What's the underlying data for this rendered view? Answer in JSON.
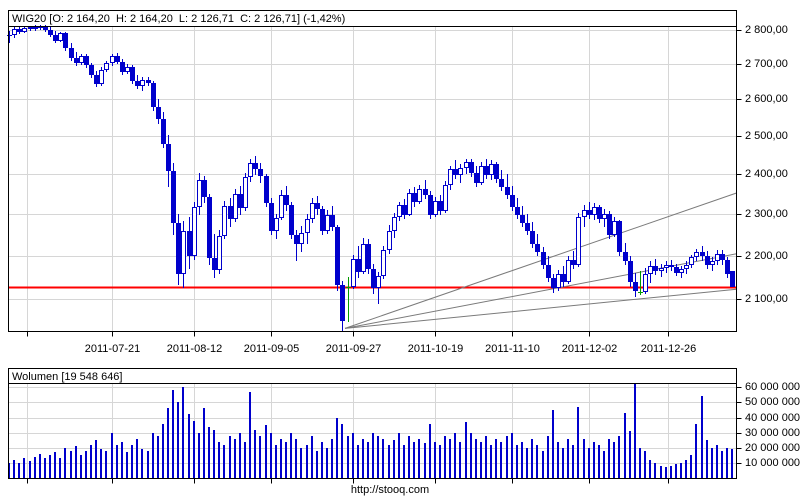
{
  "page": {
    "footer_url": "http://stooq.com"
  },
  "colors": {
    "candle_down": "#0000cc",
    "candle_up_fill": "#ffffff",
    "candle_special": "#009900",
    "volume_bar": "#0000cc",
    "red_line": "#ff0000",
    "trendline": "#7a7a7a",
    "grid": "#d6d6d6",
    "frame": "#000000"
  },
  "chart_data": {
    "type": "candlestick",
    "symbol": "WIG20",
    "title": "WIG20 [O: 2 164,20  H: 2 164,20  L: 2 126,71  C: 2 126,71] (-1,42%)",
    "volume_title": "Wolumen [19 548 646]",
    "ohlc_display": {
      "open": "2 164,20",
      "high": "2 164,20",
      "low": "2 126,71",
      "close": "2 126,71",
      "change": "-1,42%"
    },
    "scale": "log",
    "price_axis": {
      "ticks": [
        {
          "value": 2800,
          "label": "2 800,00"
        },
        {
          "value": 2700,
          "label": "2 700,00"
        },
        {
          "value": 2600,
          "label": "2 600,00"
        },
        {
          "value": 2500,
          "label": "2 500,00"
        },
        {
          "value": 2400,
          "label": "2 400,00"
        },
        {
          "value": 2300,
          "label": "2 300,00"
        },
        {
          "value": 2200,
          "label": "2 200,00"
        },
        {
          "value": 2100,
          "label": "2 100,00"
        }
      ]
    },
    "volume_axis": {
      "unit": "millions",
      "ticks": [
        {
          "value": 60,
          "label": "60 000 000"
        },
        {
          "value": 50,
          "label": "50 000 000"
        },
        {
          "value": 40,
          "label": "40 000 000"
        },
        {
          "value": 30,
          "label": "30 000 000"
        },
        {
          "value": 20,
          "label": "20 000 000"
        },
        {
          "value": 10,
          "label": "10 000 000"
        }
      ]
    },
    "x_axis": {
      "ticks": [
        {
          "i": 3.5,
          "label": ""
        },
        {
          "i": 20,
          "label": "2011-07-21"
        },
        {
          "i": 36,
          "label": "2011-08-12"
        },
        {
          "i": 51,
          "label": "2011-09-05"
        },
        {
          "i": 67,
          "label": "2011-09-27"
        },
        {
          "i": 83,
          "label": "2011-10-19"
        },
        {
          "i": 98,
          "label": "2011-11-10"
        },
        {
          "i": 113,
          "label": "2011-12-02"
        },
        {
          "i": 128.5,
          "label": "2011-12-26"
        }
      ]
    },
    "red_line_value": 2126.71,
    "trendlines": [
      {
        "from_i": 65.5,
        "from_price": 2035,
        "to_i": 142,
        "to_price": 2352
      },
      {
        "from_i": 65.5,
        "from_price": 2035,
        "to_i": 142,
        "to_price": 2204
      },
      {
        "from_i": 65.5,
        "from_price": 2035,
        "to_i": 142,
        "to_price": 2122
      }
    ],
    "special_candles": [
      66,
      123
    ],
    "candles_ohlcv": [
      [
        2784,
        2796,
        2760,
        2784,
        10
      ],
      [
        2784,
        2808,
        2776,
        2802,
        12
      ],
      [
        2802,
        2810,
        2788,
        2794,
        10
      ],
      [
        2794,
        2812,
        2790,
        2806,
        13
      ],
      [
        2806,
        2812,
        2796,
        2808,
        11
      ],
      [
        2808,
        2814,
        2798,
        2810,
        14
      ],
      [
        2810,
        2815,
        2800,
        2812,
        16
      ],
      [
        2812,
        2814,
        2794,
        2800,
        13
      ],
      [
        2800,
        2808,
        2780,
        2786,
        15
      ],
      [
        2786,
        2798,
        2760,
        2768,
        17
      ],
      [
        2768,
        2794,
        2764,
        2790,
        13
      ],
      [
        2790,
        2794,
        2738,
        2746,
        20
      ],
      [
        2746,
        2760,
        2708,
        2718,
        18
      ],
      [
        2718,
        2736,
        2694,
        2702,
        21
      ],
      [
        2702,
        2730,
        2696,
        2724,
        15
      ],
      [
        2724,
        2730,
        2688,
        2696,
        18
      ],
      [
        2696,
        2704,
        2660,
        2668,
        22
      ],
      [
        2668,
        2680,
        2634,
        2642,
        25
      ],
      [
        2642,
        2690,
        2638,
        2684,
        19
      ],
      [
        2684,
        2710,
        2676,
        2702,
        18
      ],
      [
        2702,
        2730,
        2694,
        2724,
        30
      ],
      [
        2724,
        2732,
        2700,
        2706,
        22
      ],
      [
        2706,
        2714,
        2668,
        2676,
        24
      ],
      [
        2676,
        2700,
        2670,
        2692,
        17
      ],
      [
        2692,
        2696,
        2642,
        2650,
        22
      ],
      [
        2650,
        2668,
        2628,
        2638,
        26
      ],
      [
        2638,
        2662,
        2624,
        2654,
        19
      ],
      [
        2654,
        2664,
        2636,
        2646,
        18
      ],
      [
        2646,
        2650,
        2568,
        2578,
        30
      ],
      [
        2578,
        2600,
        2532,
        2546,
        28
      ],
      [
        2546,
        2564,
        2468,
        2478,
        36
      ],
      [
        2478,
        2502,
        2368,
        2408,
        46
      ],
      [
        2408,
        2430,
        2248,
        2278,
        58
      ],
      [
        2278,
        2300,
        2132,
        2158,
        50
      ],
      [
        2158,
        2282,
        2124,
        2258,
        60
      ],
      [
        2258,
        2292,
        2168,
        2198,
        42
      ],
      [
        2198,
        2330,
        2190,
        2318,
        38
      ],
      [
        2318,
        2402,
        2298,
        2386,
        30
      ],
      [
        2386,
        2396,
        2328,
        2342,
        46
      ],
      [
        2342,
        2350,
        2178,
        2194,
        34
      ],
      [
        2194,
        2252,
        2148,
        2166,
        32
      ],
      [
        2166,
        2262,
        2158,
        2246,
        24
      ],
      [
        2246,
        2332,
        2240,
        2320,
        22
      ],
      [
        2320,
        2340,
        2268,
        2288,
        28
      ],
      [
        2288,
        2362,
        2280,
        2350,
        26
      ],
      [
        2350,
        2370,
        2298,
        2314,
        30
      ],
      [
        2314,
        2402,
        2308,
        2392,
        24
      ],
      [
        2392,
        2440,
        2380,
        2428,
        57
      ],
      [
        2428,
        2446,
        2398,
        2414,
        32
      ],
      [
        2414,
        2430,
        2378,
        2394,
        28
      ],
      [
        2394,
        2400,
        2318,
        2328,
        35
      ],
      [
        2328,
        2340,
        2248,
        2258,
        30
      ],
      [
        2258,
        2300,
        2238,
        2290,
        22
      ],
      [
        2290,
        2360,
        2284,
        2348,
        26
      ],
      [
        2348,
        2370,
        2308,
        2322,
        24
      ],
      [
        2322,
        2330,
        2238,
        2248,
        30
      ],
      [
        2248,
        2260,
        2188,
        2228,
        26
      ],
      [
        2228,
        2270,
        2208,
        2254,
        20
      ],
      [
        2254,
        2300,
        2228,
        2288,
        22
      ],
      [
        2288,
        2340,
        2278,
        2328,
        28
      ],
      [
        2328,
        2344,
        2298,
        2312,
        18
      ],
      [
        2312,
        2320,
        2248,
        2258,
        24
      ],
      [
        2258,
        2310,
        2252,
        2298,
        20
      ],
      [
        2298,
        2320,
        2258,
        2268,
        26
      ],
      [
        2268,
        2274,
        2118,
        2132,
        40
      ],
      [
        2132,
        2140,
        2030,
        2052,
        36
      ],
      [
        2126,
        2150,
        2048,
        2126,
        28
      ],
      [
        2126,
        2202,
        2122,
        2192,
        30
      ],
      [
        2192,
        2222,
        2148,
        2162,
        22
      ],
      [
        2162,
        2242,
        2158,
        2228,
        26
      ],
      [
        2228,
        2238,
        2158,
        2168,
        24
      ],
      [
        2168,
        2180,
        2112,
        2124,
        30
      ],
      [
        2124,
        2162,
        2088,
        2152,
        28
      ],
      [
        2152,
        2222,
        2146,
        2212,
        26
      ],
      [
        2212,
        2272,
        2204,
        2258,
        22
      ],
      [
        2258,
        2302,
        2242,
        2292,
        25
      ],
      [
        2292,
        2330,
        2282,
        2322,
        30
      ],
      [
        2322,
        2336,
        2288,
        2298,
        22
      ],
      [
        2298,
        2362,
        2294,
        2352,
        28
      ],
      [
        2352,
        2366,
        2318,
        2330,
        24
      ],
      [
        2330,
        2372,
        2324,
        2362,
        26
      ],
      [
        2362,
        2386,
        2338,
        2348,
        23
      ],
      [
        2348,
        2356,
        2288,
        2298,
        36
      ],
      [
        2298,
        2342,
        2292,
        2332,
        24
      ],
      [
        2332,
        2346,
        2298,
        2308,
        22
      ],
      [
        2308,
        2382,
        2302,
        2372,
        28
      ],
      [
        2372,
        2422,
        2360,
        2412,
        26
      ],
      [
        2412,
        2436,
        2388,
        2398,
        30
      ],
      [
        2398,
        2426,
        2378,
        2416,
        24
      ],
      [
        2416,
        2440,
        2400,
        2432,
        37
      ],
      [
        2432,
        2438,
        2392,
        2402,
        30
      ],
      [
        2402,
        2420,
        2368,
        2378,
        26
      ],
      [
        2378,
        2432,
        2372,
        2422,
        24
      ],
      [
        2422,
        2440,
        2388,
        2398,
        28
      ],
      [
        2398,
        2436,
        2384,
        2426,
        22
      ],
      [
        2426,
        2432,
        2378,
        2388,
        26
      ],
      [
        2388,
        2410,
        2358,
        2368,
        24
      ],
      [
        2368,
        2400,
        2338,
        2348,
        28
      ],
      [
        2348,
        2370,
        2308,
        2318,
        30
      ],
      [
        2318,
        2340,
        2288,
        2298,
        22
      ],
      [
        2298,
        2320,
        2268,
        2278,
        24
      ],
      [
        2278,
        2300,
        2248,
        2258,
        20
      ],
      [
        2258,
        2280,
        2218,
        2228,
        26
      ],
      [
        2228,
        2250,
        2198,
        2208,
        22
      ],
      [
        2208,
        2220,
        2168,
        2178,
        18
      ],
      [
        2178,
        2200,
        2138,
        2148,
        28
      ],
      [
        2148,
        2158,
        2114,
        2124,
        45
      ],
      [
        2124,
        2166,
        2118,
        2156,
        24
      ],
      [
        2156,
        2176,
        2128,
        2138,
        20
      ],
      [
        2138,
        2200,
        2134,
        2190,
        26
      ],
      [
        2190,
        2210,
        2168,
        2178,
        22
      ],
      [
        2178,
        2302,
        2174,
        2292,
        47
      ],
      [
        2292,
        2322,
        2268,
        2310,
        26
      ],
      [
        2310,
        2330,
        2288,
        2298,
        20
      ],
      [
        2298,
        2326,
        2284,
        2316,
        24
      ],
      [
        2316,
        2322,
        2278,
        2288,
        22
      ],
      [
        2288,
        2312,
        2268,
        2300,
        18
      ],
      [
        2300,
        2306,
        2238,
        2248,
        26
      ],
      [
        2248,
        2292,
        2244,
        2282,
        24
      ],
      [
        2282,
        2286,
        2198,
        2208,
        28
      ],
      [
        2208,
        2230,
        2178,
        2188,
        43
      ],
      [
        2188,
        2200,
        2128,
        2138,
        31
      ],
      [
        2138,
        2160,
        2104,
        2118,
        63
      ],
      [
        2116,
        2164,
        2108,
        2116,
        20
      ],
      [
        2116,
        2170,
        2112,
        2156,
        18
      ],
      [
        2156,
        2186,
        2136,
        2176,
        12
      ],
      [
        2176,
        2192,
        2154,
        2164,
        10
      ],
      [
        2164,
        2180,
        2150,
        2170,
        8
      ],
      [
        2170,
        2186,
        2160,
        2178,
        7
      ],
      [
        2178,
        2190,
        2164,
        2172,
        8
      ],
      [
        2172,
        2180,
        2152,
        2160,
        9
      ],
      [
        2160,
        2176,
        2148,
        2168,
        10
      ],
      [
        2168,
        2186,
        2158,
        2178,
        12
      ],
      [
        2178,
        2202,
        2170,
        2196,
        15
      ],
      [
        2196,
        2216,
        2186,
        2208,
        36
      ],
      [
        2208,
        2222,
        2188,
        2198,
        54
      ],
      [
        2198,
        2210,
        2168,
        2178,
        25
      ],
      [
        2178,
        2196,
        2164,
        2188,
        20
      ],
      [
        2188,
        2212,
        2178,
        2204,
        22
      ],
      [
        2204,
        2212,
        2178,
        2190,
        18
      ],
      [
        2190,
        2196,
        2148,
        2157,
        20
      ],
      [
        2164.2,
        2164.2,
        2126.71,
        2126.71,
        19.5
      ]
    ]
  }
}
